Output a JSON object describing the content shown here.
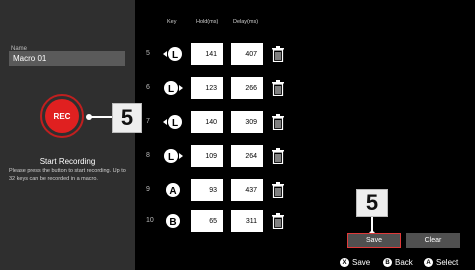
{
  "left_panel": {
    "name_label": "Name",
    "name_value": "Macro 01",
    "rec_label": "REC",
    "start_title": "Start Recording",
    "description": "Please press the button to start recording. Up to 32 keys can be recorded in a macro."
  },
  "table": {
    "headers": {
      "key": "Key",
      "hold": "Hold(ms)",
      "delay": "Delay(ms)"
    },
    "rows": [
      {
        "index": "5",
        "key": "L-stick-left",
        "hold": "141",
        "delay": "407"
      },
      {
        "index": "6",
        "key": "L-stick-right",
        "hold": "123",
        "delay": "266"
      },
      {
        "index": "7",
        "key": "L-stick-left",
        "hold": "140",
        "delay": "309"
      },
      {
        "index": "8",
        "key": "L-stick-right",
        "hold": "109",
        "delay": "264"
      },
      {
        "index": "9",
        "key": "A",
        "hold": "93",
        "delay": "437"
      },
      {
        "index": "10",
        "key": "B",
        "hold": "65",
        "delay": "311"
      }
    ]
  },
  "callouts": {
    "rec": "5",
    "save": "5"
  },
  "buttons": {
    "save": "Save",
    "clear": "Clear"
  },
  "hints": [
    {
      "glyph": "X",
      "label": "Save"
    },
    {
      "glyph": "B",
      "label": "Back"
    },
    {
      "glyph": "A",
      "label": "Select"
    }
  ],
  "colors": {
    "accent": "#e02020",
    "left_panel_bg": "#2f2f2f"
  }
}
